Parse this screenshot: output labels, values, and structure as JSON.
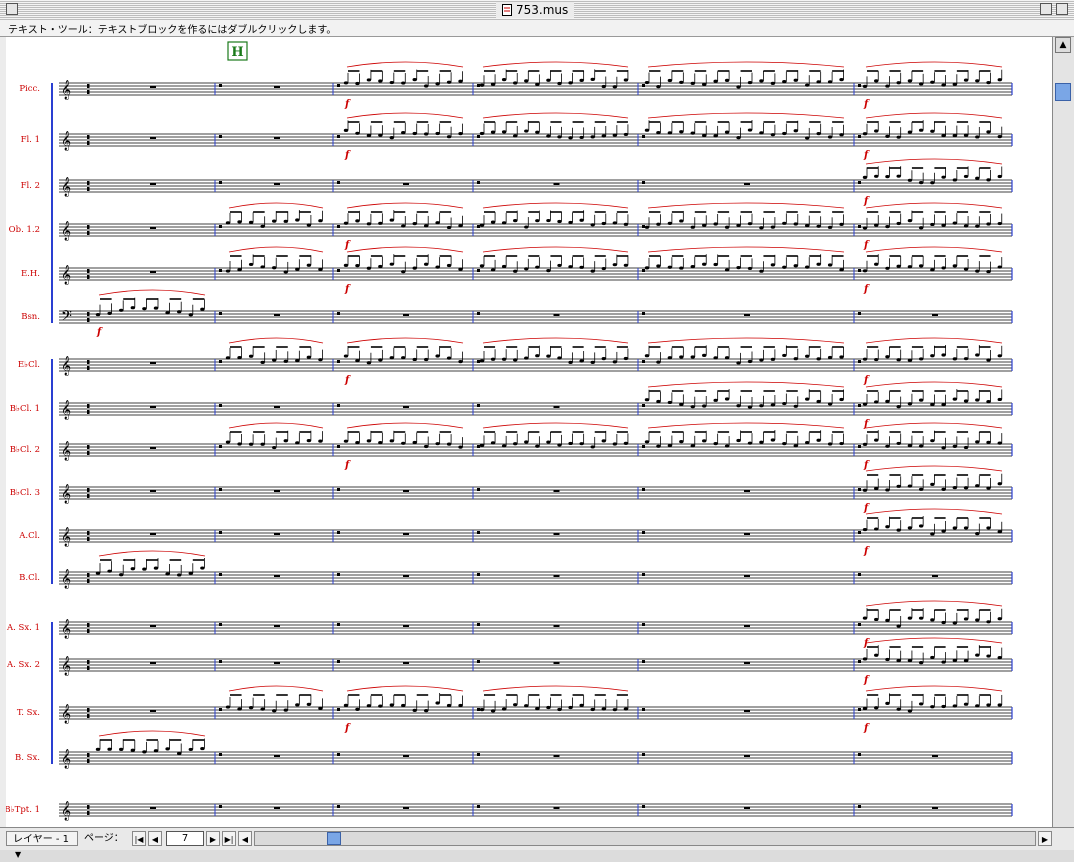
{
  "window": {
    "title": "753.mus"
  },
  "status": {
    "text": "テキスト・ツール：テキストブロックを作るにはダブルクリックします。"
  },
  "rehearsal": {
    "mark": "H"
  },
  "score": {
    "dynamic": "f",
    "instruments": [
      {
        "label": "Picc."
      },
      {
        "label": "Fl. 1"
      },
      {
        "label": "Fl. 2"
      },
      {
        "label": "Ob. 1.2"
      },
      {
        "label": "E.H."
      },
      {
        "label": "Bsn."
      },
      {
        "label": "E♭Cl."
      },
      {
        "label": "B♭Cl. 1"
      },
      {
        "label": "B♭Cl. 2"
      },
      {
        "label": "B♭Cl. 3"
      },
      {
        "label": "A.Cl."
      },
      {
        "label": "B.Cl."
      },
      {
        "label": "A. Sx. 1"
      },
      {
        "label": "A. Sx. 2"
      },
      {
        "label": "T. Sx."
      },
      {
        "label": "B. Sx."
      },
      {
        "label": "B♭Tpt. 1"
      }
    ]
  },
  "bottom": {
    "layer_label": "レイヤー - 1",
    "page_label": "ページ：",
    "page_value": "7"
  },
  "colors": {
    "accent": "#2a3fd1",
    "label_red": "#cc0000",
    "rehearsal_green": "#1a7a1a"
  }
}
